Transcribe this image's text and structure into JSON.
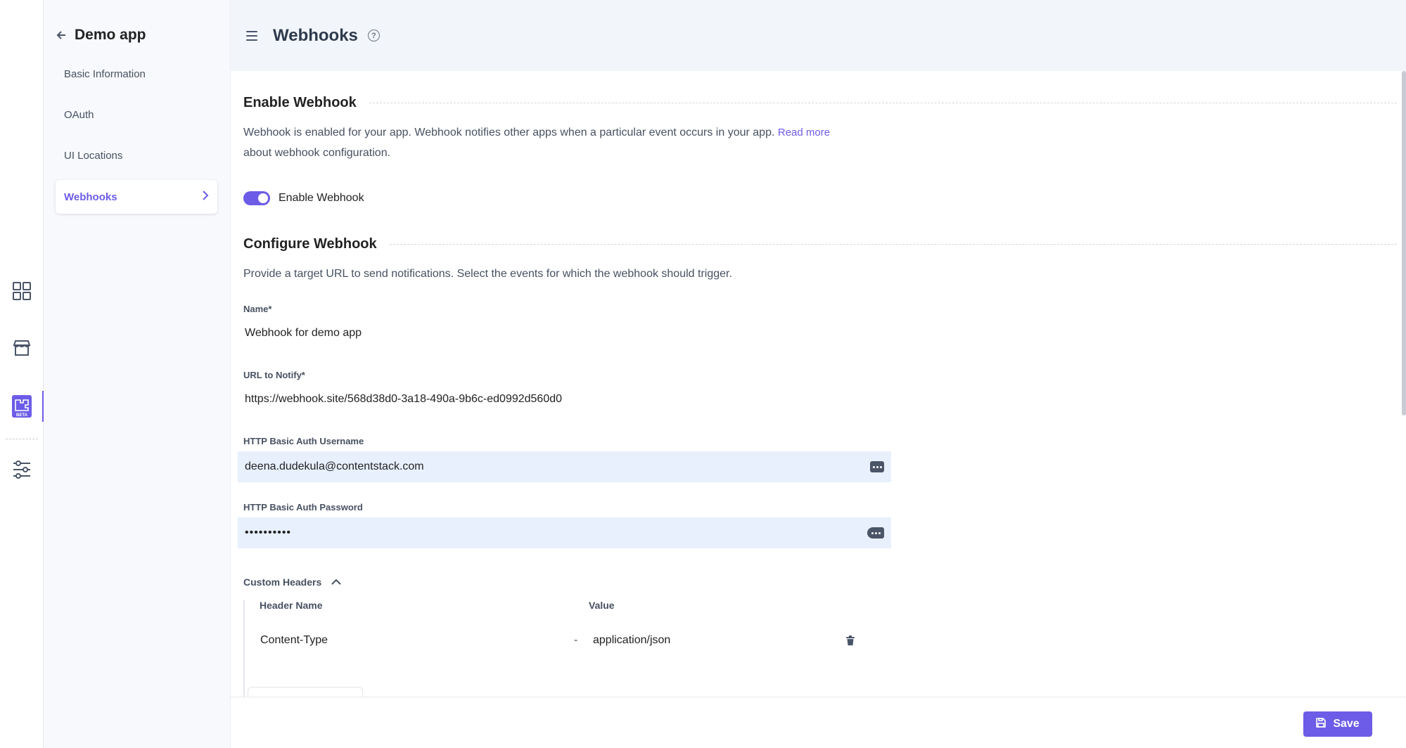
{
  "app": {
    "name": "Demo app"
  },
  "rail": {
    "items": [
      {
        "icon": "dashboard-grid-icon"
      },
      {
        "icon": "marketplace-icon"
      },
      {
        "icon": "developer-hub-icon",
        "badge": "BETA"
      },
      {
        "icon": "settings-sliders-icon"
      }
    ]
  },
  "sidebar": {
    "items": [
      {
        "label": "Basic Information"
      },
      {
        "label": "OAuth"
      },
      {
        "label": "UI Locations"
      },
      {
        "label": "Webhooks"
      }
    ]
  },
  "header": {
    "title": "Webhooks"
  },
  "enable_section": {
    "title": "Enable Webhook",
    "description": "Webhook is enabled for your app. Webhook notifies other apps when a particular event occurs in your app.",
    "read_more": "Read more",
    "description_tail": "about webhook configuration.",
    "toggle_label": "Enable Webhook",
    "toggle_on": true
  },
  "configure_section": {
    "title": "Configure Webhook",
    "description": "Provide a target URL to send notifications. Select the events for which the webhook should trigger.",
    "name_label": "Name*",
    "name_value": "Webhook for demo app",
    "url_label": "URL to Notify*",
    "url_value": "https://webhook.site/568d38d0-3a18-490a-9b6c-ed0992d560d0",
    "username_label": "HTTP Basic Auth Username",
    "username_value": "deena.dudekula@contentstack.com",
    "password_label": "HTTP Basic Auth Password",
    "password_value": "••••••••••"
  },
  "custom_headers": {
    "label": "Custom Headers",
    "col_name": "Header Name",
    "col_value": "Value",
    "rows": [
      {
        "name": "Content-Type",
        "separator": "-",
        "value": "application/json"
      }
    ]
  },
  "footer": {
    "save_label": "Save"
  },
  "colors": {
    "accent": "#6c5ce7",
    "header_bg": "#f2f6fa",
    "autofill_bg": "#e8f0fe"
  }
}
